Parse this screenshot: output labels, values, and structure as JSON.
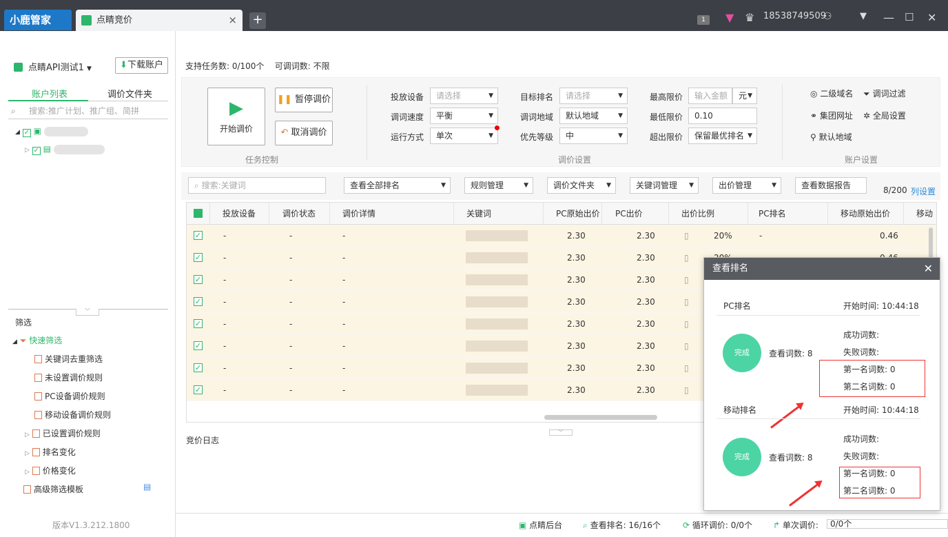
{
  "app": {
    "logo": "小鹿管家",
    "tab_title": "点睛竞价",
    "tab_close": "×",
    "new_tab": "+",
    "badge": "1",
    "phone": "18538749509"
  },
  "left": {
    "account": "点睛API测试1",
    "download": "下载账户",
    "tabs": [
      "账户列表",
      "调价文件夹"
    ],
    "search_placeholder": "搜索:推广计划、推广组、简拼",
    "filter_title": "筛选",
    "quick_filter": "快速筛选",
    "filters": [
      "关键词去重筛选",
      "未设置调价规则",
      "PC设备调价规则",
      "移动设备调价规则",
      "已设置调价规则",
      "排名变化",
      "价格变化"
    ],
    "advanced": "高级筛选模板",
    "version": "版本V1.3.212.1800"
  },
  "top": {
    "tasks": "支持任务数: 0/100个",
    "adjustable": "可调词数: 不限"
  },
  "control": {
    "start": "开始调价",
    "pause": "暂停调价",
    "cancel": "取消调价",
    "group1": "任务控制",
    "device_label": "投放设备",
    "device_ph": "请选择",
    "speed_label": "调词速度",
    "speed": "平衡",
    "mode_label": "运行方式",
    "mode": "单次",
    "target_label": "目标排名",
    "target_ph": "请选择",
    "region_label": "调词地域",
    "region": "默认地域",
    "priority_label": "优先等级",
    "priority": "中",
    "max_label": "最高限价",
    "max_ph": "输入金额",
    "unit": "元",
    "min_label": "最低限价",
    "min": "0.10",
    "over_label": "超出限价",
    "over": "保留最优排名",
    "group2": "调价设置",
    "domain": "二级域名",
    "filter": "调词过滤",
    "site": "集团网址",
    "global": "全局设置",
    "defregion": "默认地域",
    "group3": "账户设置"
  },
  "toolbar": {
    "search_ph": "搜索:关键词",
    "rank": "查看全部排名",
    "rule": "规则管理",
    "folder": "调价文件夹",
    "kw": "关键词管理",
    "bid": "出价管理",
    "report": "查看数据报告",
    "count": "8/200",
    "cols": "列设置"
  },
  "columns": [
    "投放设备",
    "调价状态",
    "调价详情",
    "关键词",
    "PC原始出价",
    "PC出价",
    "出价比例",
    "PC排名",
    "移动原始出价",
    "移动"
  ],
  "rows": [
    {
      "dev": "-",
      "status": "-",
      "detail": "-",
      "pc_orig": "2.30",
      "pc": "2.30",
      "ratio": "20%",
      "rank": "-",
      "m_orig": "0.46"
    },
    {
      "dev": "-",
      "status": "-",
      "detail": "-",
      "pc_orig": "2.30",
      "pc": "2.30",
      "ratio": "20%",
      "rank": "",
      "m_orig": "0.46"
    },
    {
      "dev": "-",
      "status": "-",
      "detail": "-",
      "pc_orig": "2.30",
      "pc": "2.30",
      "ratio": "",
      "rank": "",
      "m_orig": ""
    },
    {
      "dev": "-",
      "status": "-",
      "detail": "-",
      "pc_orig": "2.30",
      "pc": "2.30",
      "ratio": "",
      "rank": "",
      "m_orig": ""
    },
    {
      "dev": "-",
      "status": "-",
      "detail": "-",
      "pc_orig": "2.30",
      "pc": "2.30",
      "ratio": "",
      "rank": "",
      "m_orig": ""
    },
    {
      "dev": "-",
      "status": "-",
      "detail": "-",
      "pc_orig": "2.30",
      "pc": "2.30",
      "ratio": "",
      "rank": "",
      "m_orig": ""
    },
    {
      "dev": "-",
      "status": "-",
      "detail": "-",
      "pc_orig": "2.30",
      "pc": "2.30",
      "ratio": "",
      "rank": "",
      "m_orig": ""
    },
    {
      "dev": "-",
      "status": "-",
      "detail": "-",
      "pc_orig": "2.30",
      "pc": "2.30",
      "ratio": "",
      "rank": "",
      "m_orig": ""
    }
  ],
  "log": "竞价日志",
  "status": {
    "backend": "点睛后台",
    "rank": "查看排名: 16/16个",
    "loop": "循环调价: 0/0个",
    "single": "单次调价:",
    "single_val": "0/0个"
  },
  "popup": {
    "title": "查看排名",
    "pc_title": "PC排名",
    "pc_time": "开始时间: 10:44:18",
    "done": "完成",
    "view": "查看词数: 8",
    "success": "成功词数:",
    "fail": "失败词数:",
    "first": "第一名词数: 0",
    "second": "第二名词数: 0",
    "m_title": "移动排名",
    "m_time": "开始时间: 10:44:18"
  }
}
